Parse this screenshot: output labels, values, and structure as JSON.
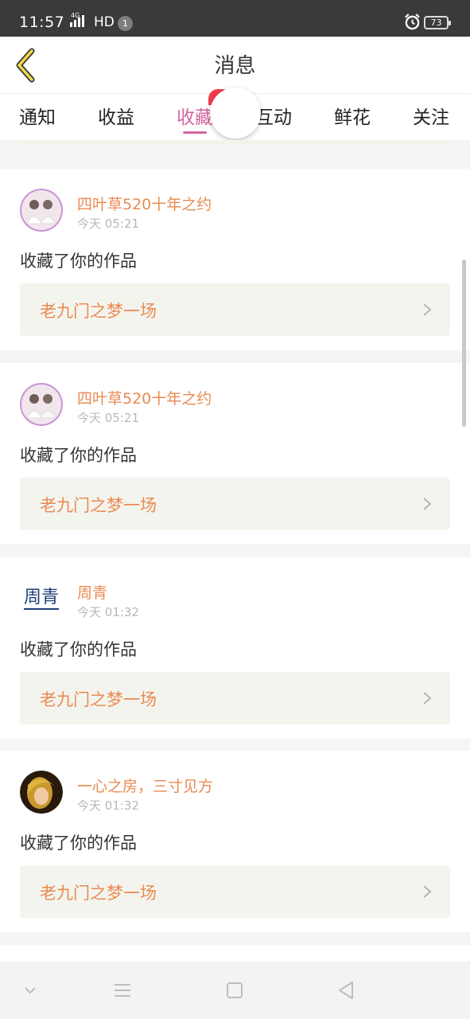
{
  "status": {
    "time": "11:57",
    "network": "4G",
    "hd": "HD",
    "notif_count": "1",
    "battery": "73"
  },
  "header": {
    "title": "消息"
  },
  "tabs": [
    {
      "label": "通知"
    },
    {
      "label": "收益"
    },
    {
      "label": "收藏",
      "active": true
    },
    {
      "label": "互动"
    },
    {
      "label": "鲜花"
    },
    {
      "label": "关注"
    }
  ],
  "messages": [
    {
      "user": "四叶草520十年之约",
      "time": "今天 05:21",
      "action": "收藏了你的作品",
      "work": "老九门之梦一场",
      "avatar": "couple-avatar"
    },
    {
      "user": "四叶草520十年之约",
      "time": "今天 05:21",
      "action": "收藏了你的作品",
      "work": "老九门之梦一场",
      "avatar": "couple-avatar"
    },
    {
      "user": "周青",
      "time": "今天 01:32",
      "action": "收藏了你的作品",
      "work": "老九门之梦一场",
      "avatar": "text-avatar",
      "avatar_text": "周青"
    },
    {
      "user": "一心之房，三寸见方",
      "time": "今天 01:32",
      "action": "收藏了你的作品",
      "work": "老九门之梦一场",
      "avatar": "photo-avatar"
    }
  ],
  "colors": {
    "accent": "#d3669d",
    "name": "#ea8a52",
    "badge": "#f23a4b"
  }
}
